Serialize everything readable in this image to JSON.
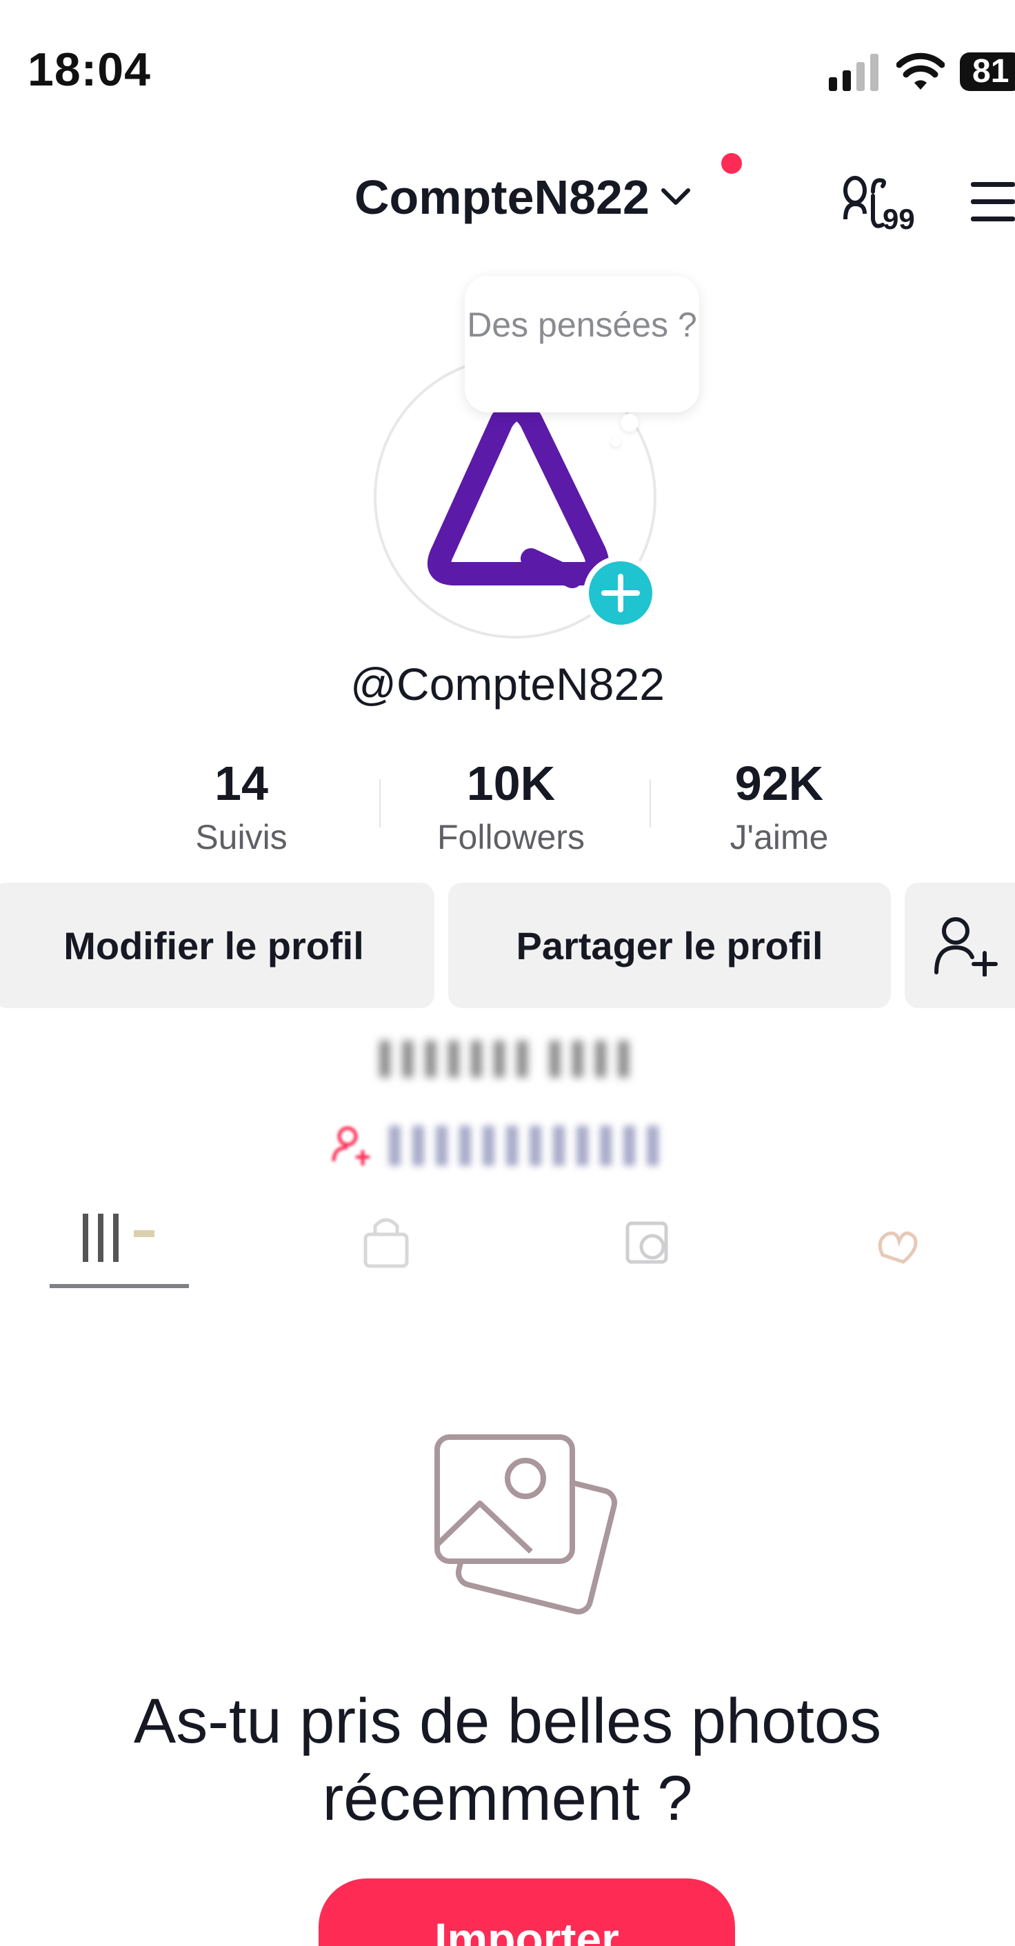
{
  "status_bar": {
    "time": "18:04",
    "battery": "81",
    "icons": [
      "signal-icon",
      "wifi-icon",
      "battery-icon"
    ]
  },
  "header": {
    "username": "CompteN822",
    "has_notification": true,
    "notification_color": "#fe2c55",
    "icons": [
      "chevron-down-icon",
      "friends-icon",
      "menu-icon"
    ]
  },
  "avatar": {
    "thought_bubble_text": "Des pensées ?",
    "add_story_color": "#20c3d0",
    "logo_color": "#5b1aa8"
  },
  "profile": {
    "handle": "@CompteN822"
  },
  "stats": [
    {
      "value": "14",
      "label": "Suivis"
    },
    {
      "value": "10K",
      "label": "Followers"
    },
    {
      "value": "92K",
      "label": "J'aime"
    }
  ],
  "actions": {
    "edit_label": "Modifier le profil",
    "share_label": "Partager le profil"
  },
  "tabs": [
    {
      "icon": "grid-icon",
      "active": true
    },
    {
      "icon": "lock-icon",
      "active": false
    },
    {
      "icon": "repost-icon",
      "active": false
    },
    {
      "icon": "liked-icon",
      "active": false
    }
  ],
  "empty_state": {
    "title": "As-tu pris de belles photos récemment ?",
    "button_label": "Importer",
    "button_color": "#fe2c55"
  }
}
